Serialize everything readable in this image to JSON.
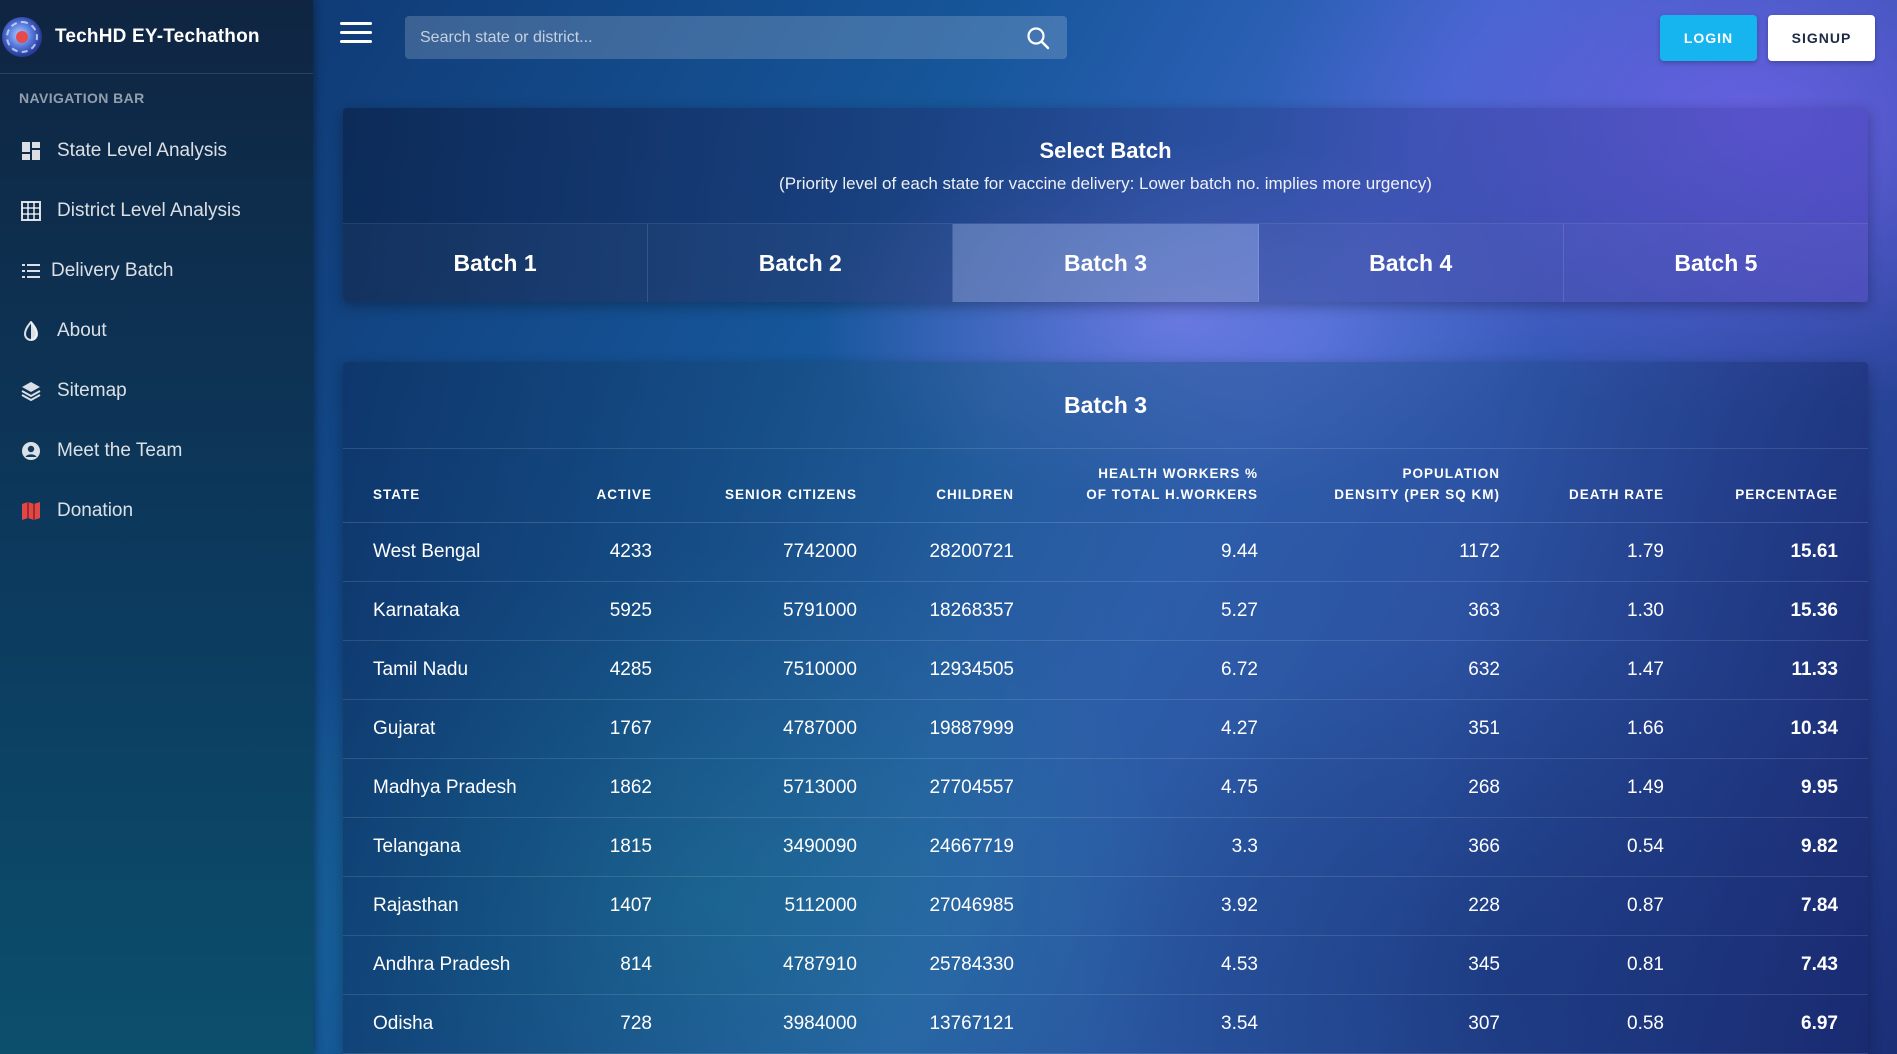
{
  "app": {
    "title": "TechHD EY-Techathon"
  },
  "sidebar": {
    "heading": "NAVIGATION BAR",
    "items": [
      {
        "label": "State Level Analysis",
        "icon": "dashboard-icon"
      },
      {
        "label": "District Level Analysis",
        "icon": "grid-icon"
      },
      {
        "label": "Delivery Batch",
        "icon": "list-icon"
      },
      {
        "label": "About",
        "icon": "half-circle-icon"
      },
      {
        "label": "Sitemap",
        "icon": "layers-icon"
      },
      {
        "label": "Meet the Team",
        "icon": "user-circle-icon"
      },
      {
        "label": "Donation",
        "icon": "map-icon"
      }
    ]
  },
  "header": {
    "search_placeholder": "Search state or district...",
    "login_label": "LOGIN",
    "signup_label": "SIGNUP"
  },
  "batch_selector": {
    "title": "Select Batch",
    "subtitle": "(Priority level of each state for vaccine delivery: Lower batch no. implies more urgency)",
    "tabs": [
      "Batch 1",
      "Batch 2",
      "Batch 3",
      "Batch 4",
      "Batch 5"
    ],
    "active_tab": "Batch 3"
  },
  "table": {
    "title": "Batch 3",
    "columns": {
      "state": "STATE",
      "active": "ACTIVE",
      "senior": "SENIOR CITIZENS",
      "children": "CHILDREN",
      "hw_line1": "HEALTH WORKERS %",
      "hw_line2": "OF TOTAL H.WORKERS",
      "pd_line1": "POPULATION",
      "pd_line2": "DENSITY (PER SQ KM)",
      "death_rate": "DEATH RATE",
      "percentage": "PERCENTAGE"
    },
    "rows": [
      [
        "West Bengal",
        "4233",
        "7742000",
        "28200721",
        "9.44",
        "1172",
        "1.79",
        "15.61"
      ],
      [
        "Karnataka",
        "5925",
        "5791000",
        "18268357",
        "5.27",
        "363",
        "1.30",
        "15.36"
      ],
      [
        "Tamil Nadu",
        "4285",
        "7510000",
        "12934505",
        "6.72",
        "632",
        "1.47",
        "11.33"
      ],
      [
        "Gujarat",
        "1767",
        "4787000",
        "19887999",
        "4.27",
        "351",
        "1.66",
        "10.34"
      ],
      [
        "Madhya Pradesh",
        "1862",
        "5713000",
        "27704557",
        "4.75",
        "268",
        "1.49",
        "9.95"
      ],
      [
        "Telangana",
        "1815",
        "3490090",
        "24667719",
        "3.3",
        "366",
        "0.54",
        "9.82"
      ],
      [
        "Rajasthan",
        "1407",
        "5112000",
        "27046985",
        "3.92",
        "228",
        "0.87",
        "7.84"
      ],
      [
        "Andhra Pradesh",
        "814",
        "4787910",
        "25784330",
        "4.53",
        "345",
        "0.81",
        "7.43"
      ],
      [
        "Odisha",
        "728",
        "3984000",
        "13767121",
        "3.54",
        "307",
        "0.58",
        "6.97"
      ]
    ]
  }
}
